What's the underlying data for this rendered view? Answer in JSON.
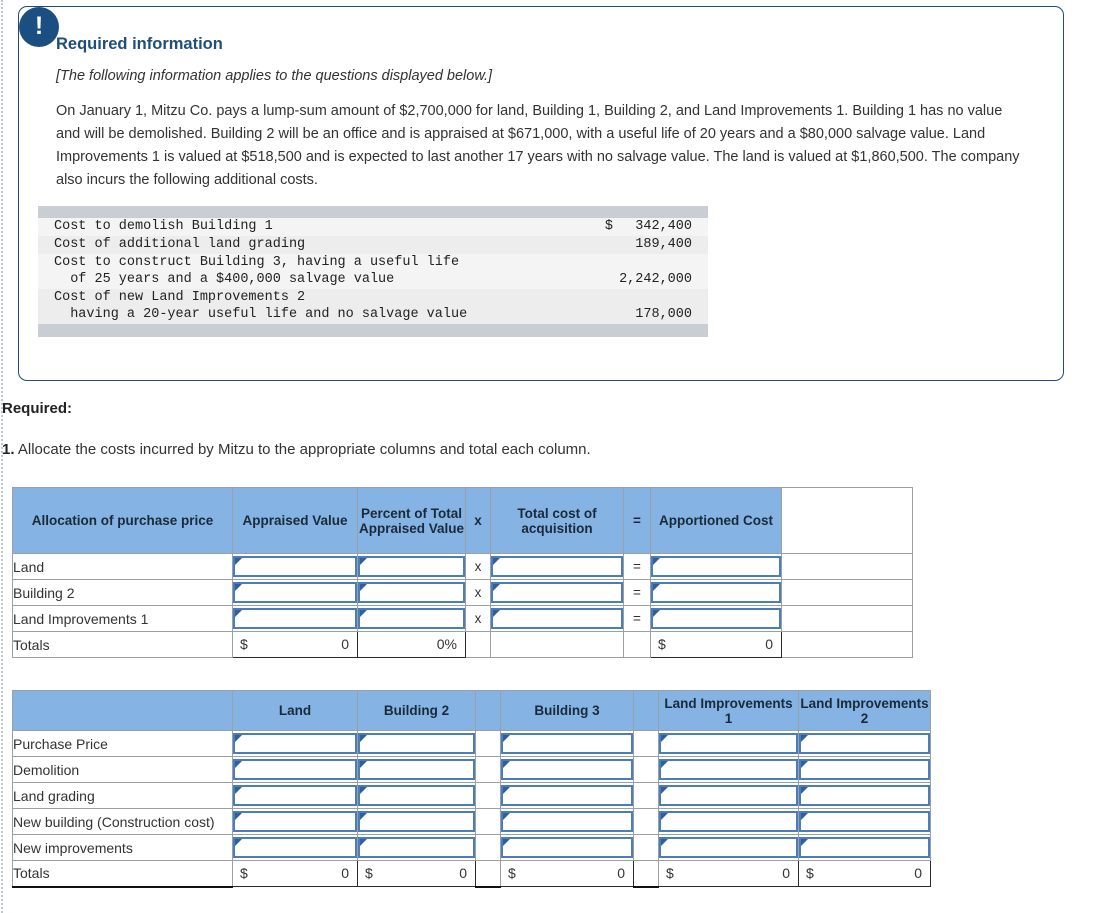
{
  "callout": {
    "icon": "exclamation-icon",
    "title": "Required information",
    "subtitle": "[The following information applies to the questions displayed below.]",
    "body": "On January 1, Mitzu Co. pays a lump-sum amount of $2,700,000 for land, Building 1, Building 2, and Land Improvements 1. Building 1 has no value and will be demolished. Building 2 will be an office and is appraised at $671,000, with a useful life of 20 years and a $80,000 salvage value. Land Improvements 1 is valued at $518,500 and is expected to last another 17 years with no salvage value. The land is valued at $1,860,500. The company also incurs the following additional costs."
  },
  "cost_table": {
    "rows": [
      {
        "label": "Cost to demolish Building 1",
        "symbol": "$",
        "amount": "342,400"
      },
      {
        "label": "Cost of additional land grading",
        "symbol": "",
        "amount": "189,400"
      },
      {
        "label": "Cost to construct Building 3, having a useful life\n  of 25 years and a $400,000 salvage value",
        "symbol": "",
        "amount": "2,242,000"
      },
      {
        "label": "Cost of new Land Improvements 2\n  having a 20-year useful life and no salvage value",
        "symbol": "",
        "amount": "178,000"
      }
    ]
  },
  "required": {
    "heading": "Required:",
    "item_number": "1.",
    "item_text": "Allocate the costs incurred by Mitzu to the appropriate columns and total each column."
  },
  "table1": {
    "headers": {
      "row_label": "Allocation of purchase price",
      "appraised_value": "Appraised Value",
      "percent_total": "Percent of Total Appraised Value",
      "times": "x",
      "total_cost": "Total cost of acquisition",
      "equals": "=",
      "apportioned": "Apportioned Cost"
    },
    "rows": [
      {
        "label": "Land",
        "op1": "x",
        "op2": "="
      },
      {
        "label": "Building 2",
        "op1": "x",
        "op2": "="
      },
      {
        "label": "Land Improvements 1",
        "op1": "x",
        "op2": "="
      }
    ],
    "totals": {
      "label": "Totals",
      "appraised_dollar": "$",
      "appraised_value": "0",
      "percent_value": "0%",
      "apportioned_dollar": "$",
      "apportioned_value": "0"
    }
  },
  "table2": {
    "headers": {
      "row_label": "",
      "land": "Land",
      "building2": "Building 2",
      "building3": "Building 3",
      "land_improvements_1": "Land Improvements 1",
      "land_improvements_2": "Land Improvements 2"
    },
    "rows": [
      {
        "label": "Purchase Price"
      },
      {
        "label": "Demolition"
      },
      {
        "label": "Land grading"
      },
      {
        "label": "New building (Construction cost)"
      },
      {
        "label": "New improvements"
      }
    ],
    "totals": {
      "label": "Totals",
      "land_dollar": "$",
      "land_value": "0",
      "b2_dollar": "$",
      "b2_value": "0",
      "b3_dollar": "$",
      "b3_value": "0",
      "li1_dollar": "$",
      "li1_value": "0",
      "li2_dollar": "$",
      "li2_value": "0"
    }
  },
  "colors": {
    "header_blue": "#85b3e3",
    "callout_border": "#1f4e79",
    "title_blue": "#1f4e79",
    "input_border": "#4a7dba",
    "icon_navy": "#1b4f82"
  }
}
